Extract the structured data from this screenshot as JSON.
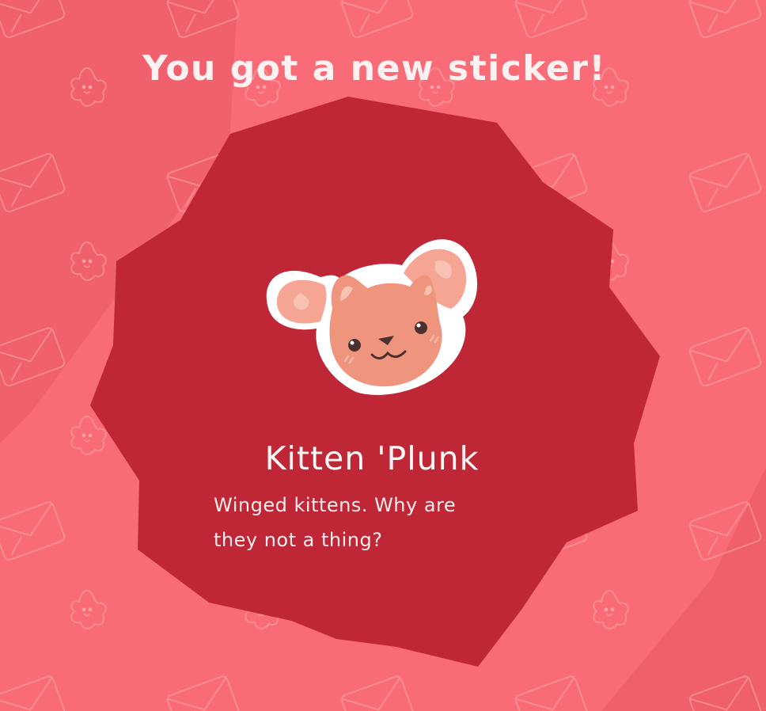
{
  "reward": {
    "title": "You got a new sticker!",
    "sticker_name": "Kitten 'Plunk",
    "sticker_description": "Winged kittens. Why are they not a thing?",
    "sticker_icon": "winged-kitten-face-icon"
  },
  "colors": {
    "background": "#f86b77",
    "background_dark": "#e95866",
    "badge": "#bf2737",
    "text": "#fff5f5",
    "sticker_fur": "#ef957d",
    "sticker_wing": "#f6a494"
  },
  "background_pattern_icons": [
    "envelope-icon",
    "flower-icon"
  ]
}
